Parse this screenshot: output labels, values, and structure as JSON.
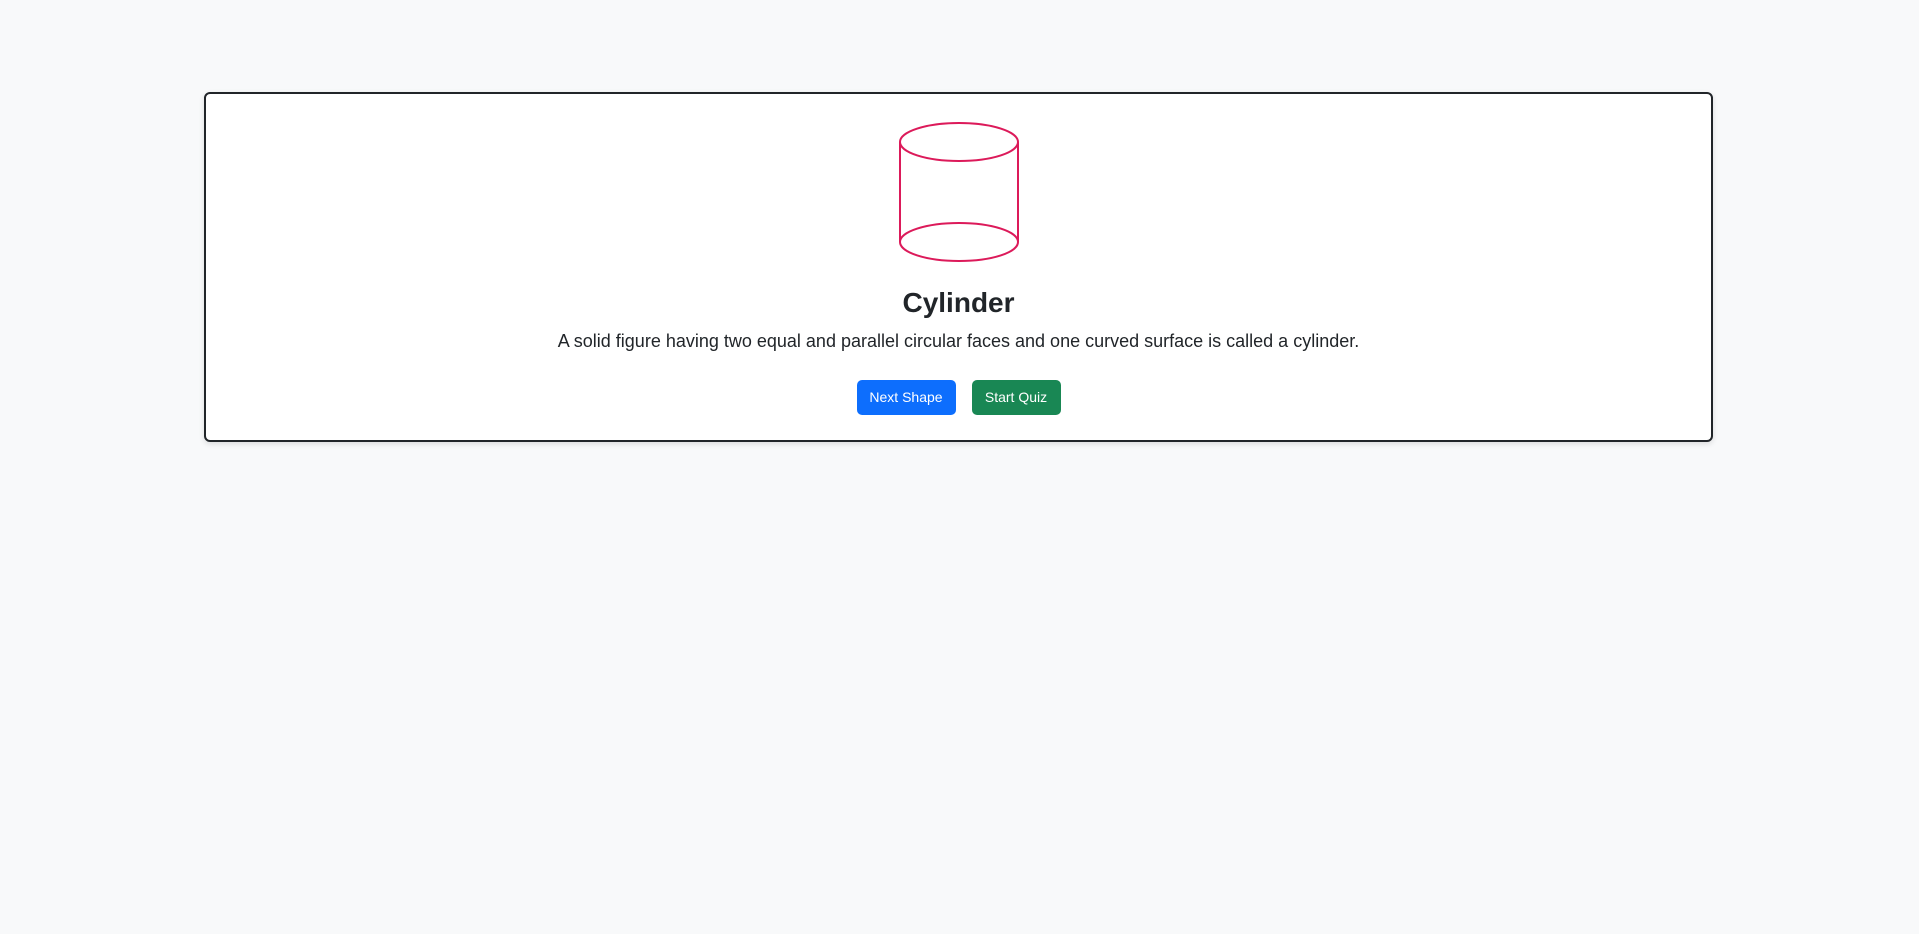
{
  "shape": {
    "name": "Cylinder",
    "description": "A solid figure having two equal and parallel circular faces and one curved surface is called a cylinder.",
    "icon": "cylinder-icon",
    "stroke_color": "#dc1a5a"
  },
  "actions": {
    "next_label": "Next Shape",
    "quiz_label": "Start Quiz"
  },
  "colors": {
    "primary": "#0d6efd",
    "success": "#198754",
    "background": "#f8f9fa"
  }
}
